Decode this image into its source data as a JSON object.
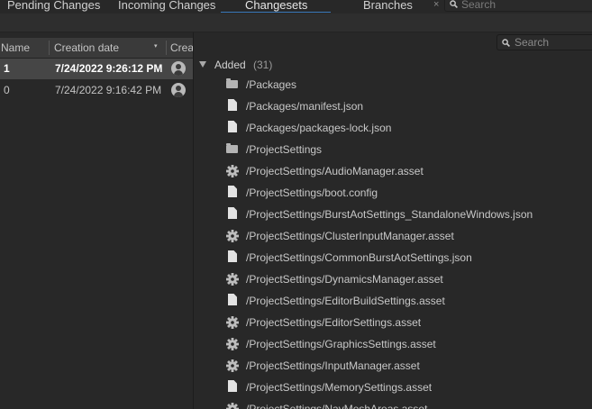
{
  "tabs": [
    {
      "label": "Pending Changes"
    },
    {
      "label": "Incoming Changes"
    },
    {
      "label": "Changesets"
    },
    {
      "label": "Branches"
    }
  ],
  "tab_close_glyph": "×",
  "top_search": {
    "placeholder": "Search",
    "icon": "search-icon"
  },
  "changesets_table": {
    "columns": [
      {
        "label": "Name"
      },
      {
        "label": "Creation date"
      },
      {
        "label": "Crea"
      }
    ],
    "sort_indicator": "▾",
    "rows": [
      {
        "name": "1",
        "date": "7/24/2022 9:26:12 PM",
        "selected": true
      },
      {
        "name": "0",
        "date": "7/24/2022 9:16:42 PM",
        "selected": false
      }
    ]
  },
  "details": {
    "search_placeholder": "Search",
    "group": {
      "label": "Added",
      "count": "(31)"
    },
    "items": [
      {
        "path": "/Packages",
        "icon": "folder-icon"
      },
      {
        "path": "/Packages/manifest.json",
        "icon": "file-icon"
      },
      {
        "path": "/Packages/packages-lock.json",
        "icon": "file-icon"
      },
      {
        "path": "/ProjectSettings",
        "icon": "folder-icon"
      },
      {
        "path": "/ProjectSettings/AudioManager.asset",
        "icon": "gear-icon"
      },
      {
        "path": "/ProjectSettings/boot.config",
        "icon": "file-icon"
      },
      {
        "path": "/ProjectSettings/BurstAotSettings_StandaloneWindows.json",
        "icon": "file-icon"
      },
      {
        "path": "/ProjectSettings/ClusterInputManager.asset",
        "icon": "gear-icon"
      },
      {
        "path": "/ProjectSettings/CommonBurstAotSettings.json",
        "icon": "file-icon"
      },
      {
        "path": "/ProjectSettings/DynamicsManager.asset",
        "icon": "gear-icon"
      },
      {
        "path": "/ProjectSettings/EditorBuildSettings.asset",
        "icon": "file-icon"
      },
      {
        "path": "/ProjectSettings/EditorSettings.asset",
        "icon": "gear-icon"
      },
      {
        "path": "/ProjectSettings/GraphicsSettings.asset",
        "icon": "gear-icon"
      },
      {
        "path": "/ProjectSettings/InputManager.asset",
        "icon": "gear-icon"
      },
      {
        "path": "/ProjectSettings/MemorySettings.asset",
        "icon": "file-icon"
      },
      {
        "path": "/ProjectSettings/NavMeshAreas.asset",
        "icon": "gear-icon"
      }
    ]
  },
  "colors": {
    "accent": "#3a79bb",
    "selected_row": "#464646",
    "background": "#282828"
  }
}
